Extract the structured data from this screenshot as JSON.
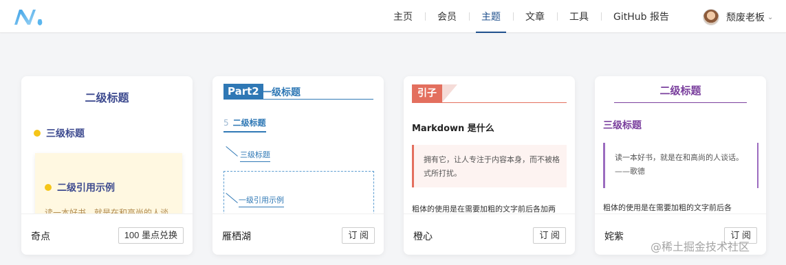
{
  "header": {
    "logo_icon": "juejin-logo-icon",
    "nav": [
      {
        "label": "主页",
        "active": false
      },
      {
        "label": "会员",
        "active": false
      },
      {
        "label": "主题",
        "active": true
      },
      {
        "label": "文章",
        "active": false
      },
      {
        "label": "工具",
        "active": false
      },
      {
        "label": "GitHub 报告",
        "active": false
      }
    ],
    "user": {
      "name": "颓废老板",
      "dropdown_icon": "chevron-down-icon"
    }
  },
  "cards": [
    {
      "name": "奇点",
      "action": "100 墨点兑换",
      "preview": {
        "h2": "二级标题",
        "h3": "三级标题",
        "quote_title": "二级引用示例",
        "quote_text": "读一本好书，就是在和高尚的人谈"
      }
    },
    {
      "name": "雁栖湖",
      "action": "订 阅",
      "preview": {
        "part_tag": "Part2",
        "h2": "一级标题",
        "h3_num": "5",
        "h3": "二级标题",
        "h4": "三级标题",
        "quote_title": "一级引用示例"
      }
    },
    {
      "name": "橙心",
      "action": "订 阅",
      "preview": {
        "tag": "引子",
        "h2": "Markdown 是什么",
        "quote": "拥有它，让人专注于内容本身，而不被格式所打扰。",
        "paragraph": "粗体的使用是在需要加粗的文字前后各加两"
      }
    },
    {
      "name": "姹紫",
      "action": "订 阅",
      "preview": {
        "h2": "二级标题",
        "h3": "三级标题",
        "quote": "读一本好书，就是在和高尚的人谈话。 ——歌德",
        "paragraph": "粗体的使用是在需要加粗的文字前后各"
      }
    }
  ],
  "watermark": "@稀土掘金技术社区",
  "colors": {
    "nav_active": "#1e4f8c",
    "qidian": "#3d4a8f",
    "yanqihu": "#2f78b5",
    "chengxin": "#e36f5e",
    "chazi": "#7a3f9d"
  }
}
